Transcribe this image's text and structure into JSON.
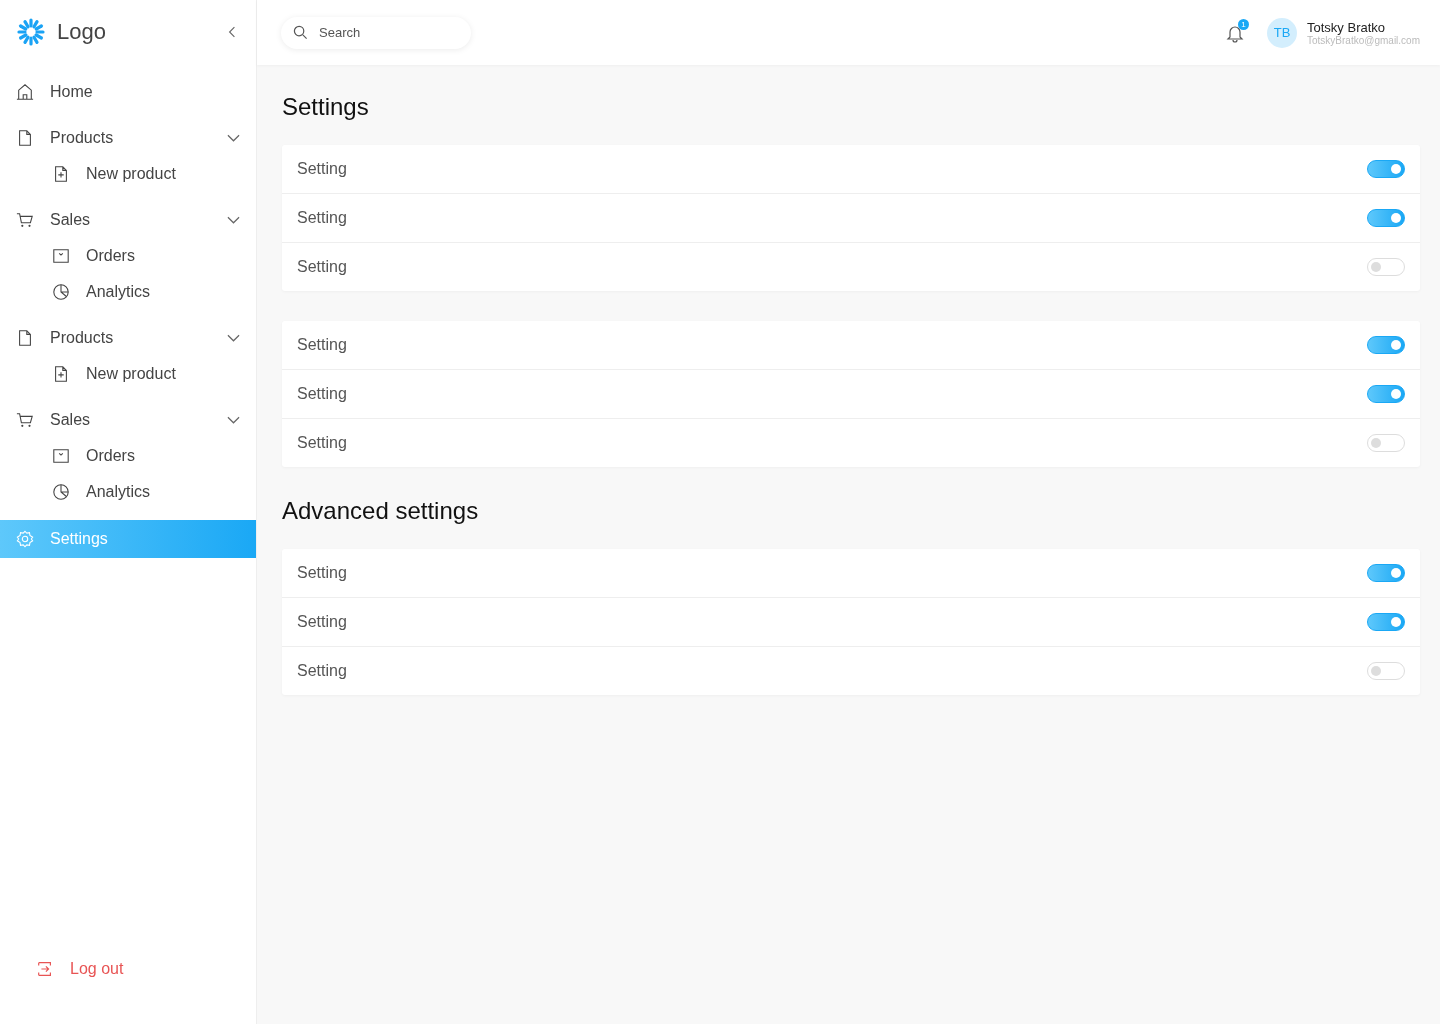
{
  "logo": {
    "text": "Logo"
  },
  "sidebar": {
    "items": [
      {
        "kind": "home",
        "label": "Home",
        "selected": false
      },
      {
        "kind": "file",
        "label": "Products",
        "selected": false,
        "expanded": true,
        "children": [
          {
            "kind": "new",
            "label": "New product",
            "selected": false
          }
        ]
      },
      {
        "kind": "cart",
        "label": "Sales",
        "selected": false,
        "expanded": true,
        "children": [
          {
            "kind": "orders",
            "label": "Orders",
            "selected": false
          },
          {
            "kind": "analytics",
            "label": "Analytics",
            "selected": false
          }
        ]
      },
      {
        "kind": "file",
        "label": "Products",
        "selected": false,
        "expanded": true,
        "children": [
          {
            "kind": "new",
            "label": "New product",
            "selected": false
          }
        ]
      },
      {
        "kind": "cart",
        "label": "Sales",
        "selected": false,
        "expanded": true,
        "children": [
          {
            "kind": "orders",
            "label": "Orders",
            "selected": false
          },
          {
            "kind": "analytics",
            "label": "Analytics",
            "selected": false
          }
        ]
      },
      {
        "kind": "gear",
        "label": "Settings",
        "selected": true
      }
    ],
    "logout": "Log out"
  },
  "search": {
    "placeholder": "Search"
  },
  "notifications": {
    "count": "1"
  },
  "user": {
    "initials": "TB",
    "name": "Totsky Bratko",
    "email": "TotskyBratko@gmail.com"
  },
  "sections": [
    {
      "title": "Settings",
      "cards": [
        {
          "rows": [
            {
              "label": "Setting",
              "on": true
            },
            {
              "label": "Setting",
              "on": true
            },
            {
              "label": "Setting",
              "on": false
            }
          ]
        },
        {
          "rows": [
            {
              "label": "Setting",
              "on": true
            },
            {
              "label": "Setting",
              "on": true
            },
            {
              "label": "Setting",
              "on": false
            }
          ]
        }
      ]
    },
    {
      "title": "Advanced settings",
      "cards": [
        {
          "rows": [
            {
              "label": "Setting",
              "on": true
            },
            {
              "label": "Setting",
              "on": true
            },
            {
              "label": "Setting",
              "on": false
            }
          ]
        }
      ]
    }
  ]
}
